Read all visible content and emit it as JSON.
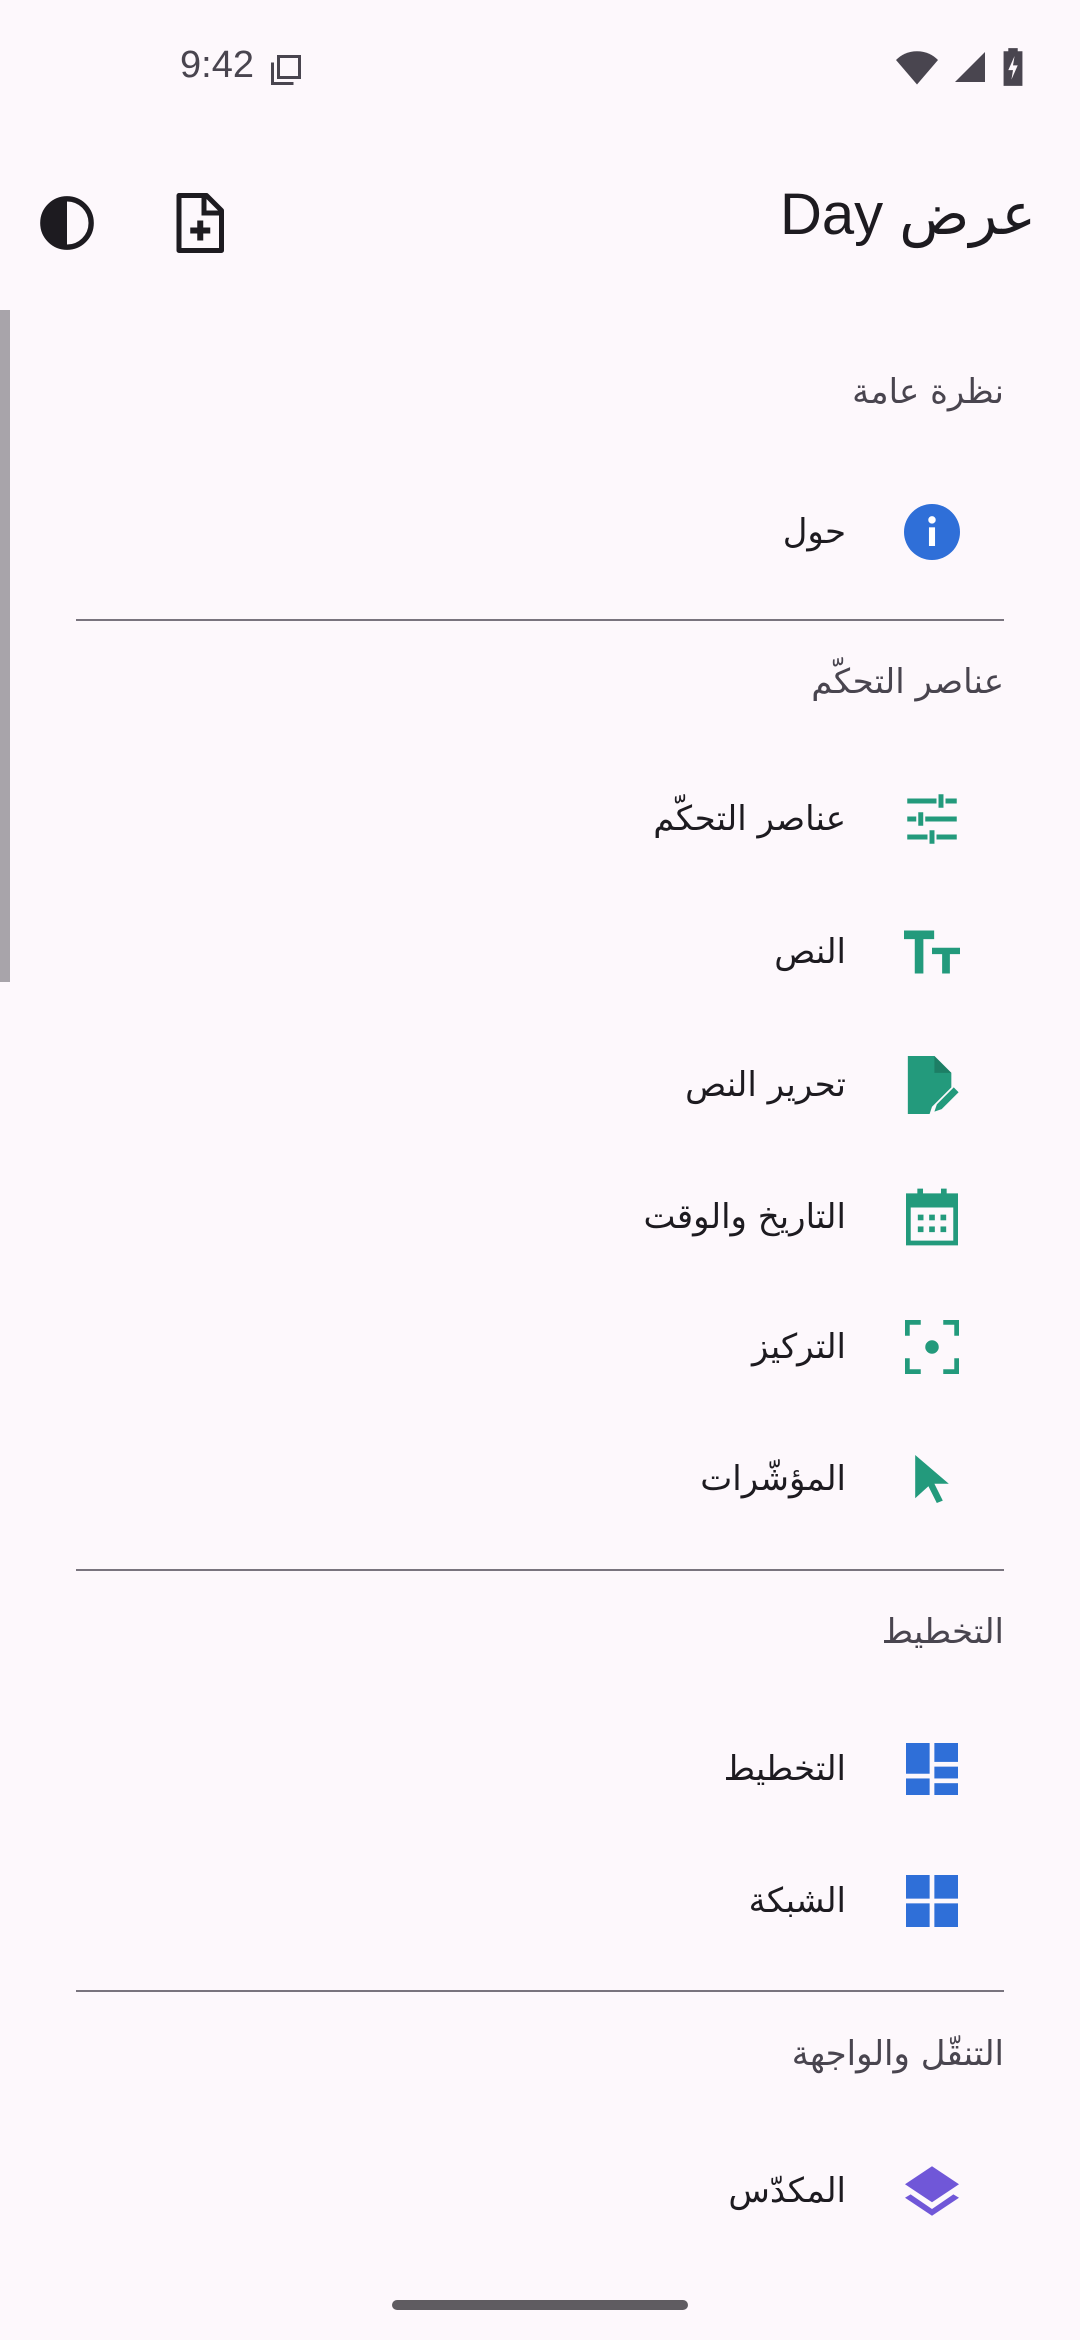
{
  "status_bar": {
    "time": "9:42"
  },
  "app_bar": {
    "title": "عرض Day"
  },
  "sections": [
    {
      "header": "نظرة عامة",
      "items": [
        {
          "label": "حول",
          "icon": "info-icon"
        }
      ]
    },
    {
      "header": "عناصر التحكّم",
      "items": [
        {
          "label": "عناصر التحكّم",
          "icon": "tune-icon"
        },
        {
          "label": "النص",
          "icon": "text-fields-icon"
        },
        {
          "label": "تحرير النص",
          "icon": "edit-document-icon"
        },
        {
          "label": "التاريخ والوقت",
          "icon": "calendar-icon"
        },
        {
          "label": "التركيز",
          "icon": "focus-icon"
        },
        {
          "label": "المؤشّرات",
          "icon": "pointer-icon"
        }
      ]
    },
    {
      "header": "التخطيط",
      "items": [
        {
          "label": "التخطيط",
          "icon": "layout-icon"
        },
        {
          "label": "الشبكة",
          "icon": "grid-icon"
        }
      ]
    },
    {
      "header": "التنقّل والواجهة",
      "items": [
        {
          "label": "المكدّس",
          "icon": "layers-icon"
        }
      ]
    }
  ],
  "colors": {
    "background": "#fdf8fc",
    "info_blue": "#2f6fd8",
    "controls_teal": "#239a7c",
    "layout_blue": "#2f6fd8",
    "stack_purple": "#7057d8"
  }
}
